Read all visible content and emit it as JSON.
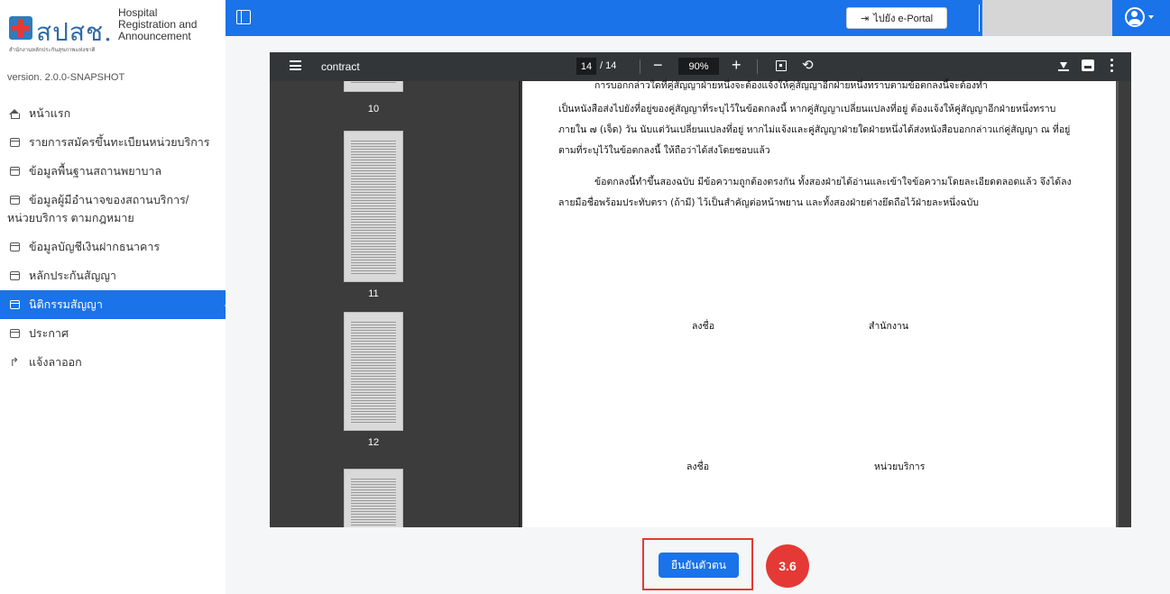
{
  "brand": {
    "logo_text": "สปสช.",
    "logo_subtitle": "สำนักงานหลักประกันสุขภาพแห่งชาติ",
    "title_line1": "Hospital",
    "title_line2": "Registration and",
    "title_line3": "Announcement",
    "version": "version. 2.0.0-SNAPSHOT"
  },
  "sidebar": {
    "items": [
      {
        "label": "หน้าแรก",
        "icon": "home-icon"
      },
      {
        "label": "รายการสมัครขึ้นทะเบียนหน่วยบริการ",
        "icon": "list-box-icon"
      },
      {
        "label": "ข้อมูลพื้นฐานสถานพยาบาล",
        "icon": "list-box-icon"
      },
      {
        "label": "ข้อมูลผู้มีอำนาจของสถานบริการ/",
        "label2": "หน่วยบริการ ตามกฎหมาย",
        "icon": "list-box-icon"
      },
      {
        "label": "ข้อมูลบัญชีเงินฝากธนาคาร",
        "icon": "list-box-icon"
      },
      {
        "label": "หลักประกันสัญญา",
        "icon": "list-box-icon"
      },
      {
        "label": "นิติกรรมสัญญา",
        "icon": "list-box-icon",
        "active": true
      },
      {
        "label": "ประกาศ",
        "icon": "list-box-icon"
      },
      {
        "label": "แจ้งลาออก",
        "icon": "exit-arrow-icon"
      }
    ]
  },
  "topbar": {
    "portal_button": "ไปยัง e-Portal",
    "portal_icon": "login-icon"
  },
  "pdf": {
    "title": "contract",
    "current_page": "14",
    "total_pages": "/ 14",
    "zoom": "90%",
    "thumb_labels": [
      "10",
      "11",
      "12"
    ]
  },
  "document": {
    "para1_clip": "การบอกกล่าวใดที่คู่สัญญาฝ่ายหนึ่งจะต้องแจ้งให้คู่สัญญาอีกฝ่ายหนึ่งทราบตามข้อตกลงนี้จะต้องทำ",
    "para1": "เป็นหนังสือส่งไปยังที่อยู่ของคู่สัญญาที่ระบุไว้ในข้อตกลงนี้ หากคู่สัญญาเปลี่ยนแปลงที่อยู่ ต้องแจ้งให้คู่สัญญาอีกฝ่ายหนึ่งทราบภายใน ๗ (เจ็ด) วัน นับแต่วันเปลี่ยนแปลงที่อยู่ หากไม่แจ้งและคู่สัญญาฝ่ายใดฝ่ายหนึ่งได้ส่งหนังสือบอกกล่าวแก่คู่สัญญา ณ ที่อยู่ตามที่ระบุไว้ในข้อตกลงนี้ ให้ถือว่าได้ส่งโดยชอบแล้ว",
    "para2": "ข้อตกลงนี้ทำขึ้นสองฉบับ มีข้อความถูกต้องตรงกัน ทั้งสองฝ่ายได้อ่านและเข้าใจข้อความโดยละเอียดตลอดแล้ว จึงได้ลงลายมือชื่อพร้อมประทับตรา (ถ้ามี) ไว้เป็นสำคัญต่อหน้าพยาน และทั้งสองฝ่ายต่างยึดถือไว้ฝ่ายละหนึ่งฉบับ",
    "sign1_label": "ลงชื่อ",
    "sign1_party": "สำนักงาน",
    "sign2_label": "ลงชื่อ",
    "sign2_party": "หน่วยบริการ"
  },
  "actions": {
    "confirm_button": "ยืนยันตัวตน",
    "step_badge": "3.6"
  },
  "colors": {
    "primary": "#1a73e8",
    "highlight": "#e53935",
    "pdf_toolbar": "#323639"
  }
}
